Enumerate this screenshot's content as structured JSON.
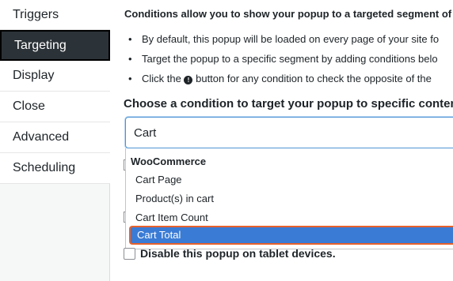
{
  "sidebar": {
    "items": [
      {
        "label": "Triggers"
      },
      {
        "label": "Targeting"
      },
      {
        "label": "Display"
      },
      {
        "label": "Close"
      },
      {
        "label": "Advanced"
      },
      {
        "label": "Scheduling"
      }
    ],
    "active": "Targeting"
  },
  "main": {
    "intro": "Conditions allow you to show your popup to a targeted segment of",
    "bullets": [
      "By default, this popup will be loaded on every page of your site fo",
      "Target the popup to a specific segment by adding conditions belo",
      "button for any condition to check the opposite of the"
    ],
    "bullet3_prefix": "Click the",
    "info_icon": "exclamation-icon",
    "choose_heading": "Choose a condition to target your popup to specific content",
    "search": {
      "value": "Cart"
    },
    "dropdown": {
      "group": "WooCommerce",
      "options": [
        "Cart Page",
        "Product(s) in cart",
        "Cart Item Count",
        "Cart Total"
      ],
      "highlighted": "Cart Total"
    },
    "tablet_checkbox_label": "Disable this popup on tablet devices."
  },
  "colors": {
    "active_sidebar_bg": "#2c3338",
    "highlight_bg": "#3a7bd5",
    "highlight_border": "#e7622c",
    "focus_border": "#4f94d4"
  }
}
